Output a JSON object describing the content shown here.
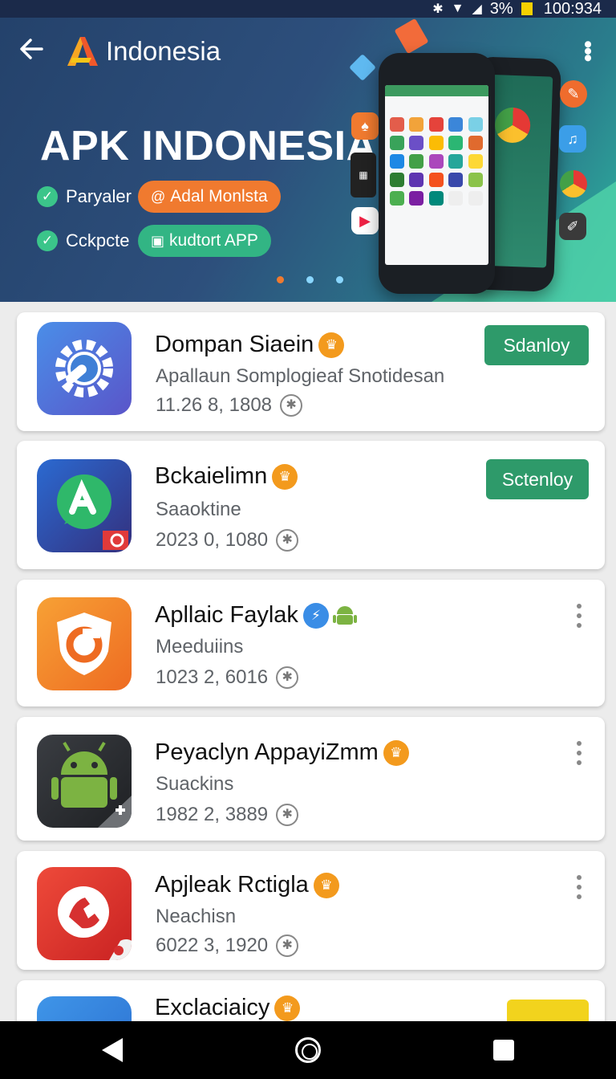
{
  "status_bar": {
    "battery": "3%",
    "time": "100:934"
  },
  "header": {
    "title": "Indonesia"
  },
  "banner": {
    "headline": "APK INDONESIA",
    "features": [
      {
        "label": "Paryaler",
        "pill": "Adal Monlsta",
        "pill_color": "#f07a2f"
      },
      {
        "label": "Cckpcte",
        "pill": "kudtort APP",
        "pill_color": "#32b584"
      }
    ]
  },
  "apps": [
    {
      "name": "Dompan Siaein",
      "subtitle": "Apallaun Somplogieaf Snotidesan",
      "meta": "11.26 8, 1808",
      "action": "Sdanloy"
    },
    {
      "name": "Bckaielimn",
      "subtitle": "Saaoktine",
      "meta": "2023 0, 1080",
      "action": "Sctenloy"
    },
    {
      "name": "Apllaic Faylak",
      "subtitle": "Meeduiins",
      "meta": "1023 2, 6016"
    },
    {
      "name": "Peyaclyn AppayiZmm",
      "subtitle": "Suackins",
      "meta": "1982 2, 3889"
    },
    {
      "name": "Apjleak Rctigla",
      "subtitle": "Neachisn",
      "meta": "6022 3, 1920"
    },
    {
      "name": "Exclaciaicy",
      "subtitle": "",
      "meta": ""
    }
  ],
  "colors": {
    "accent_green": "#2e9a6a",
    "accent_orange": "#f39a1d",
    "banner_start": "#24426b",
    "banner_end": "#2fb6a0"
  }
}
